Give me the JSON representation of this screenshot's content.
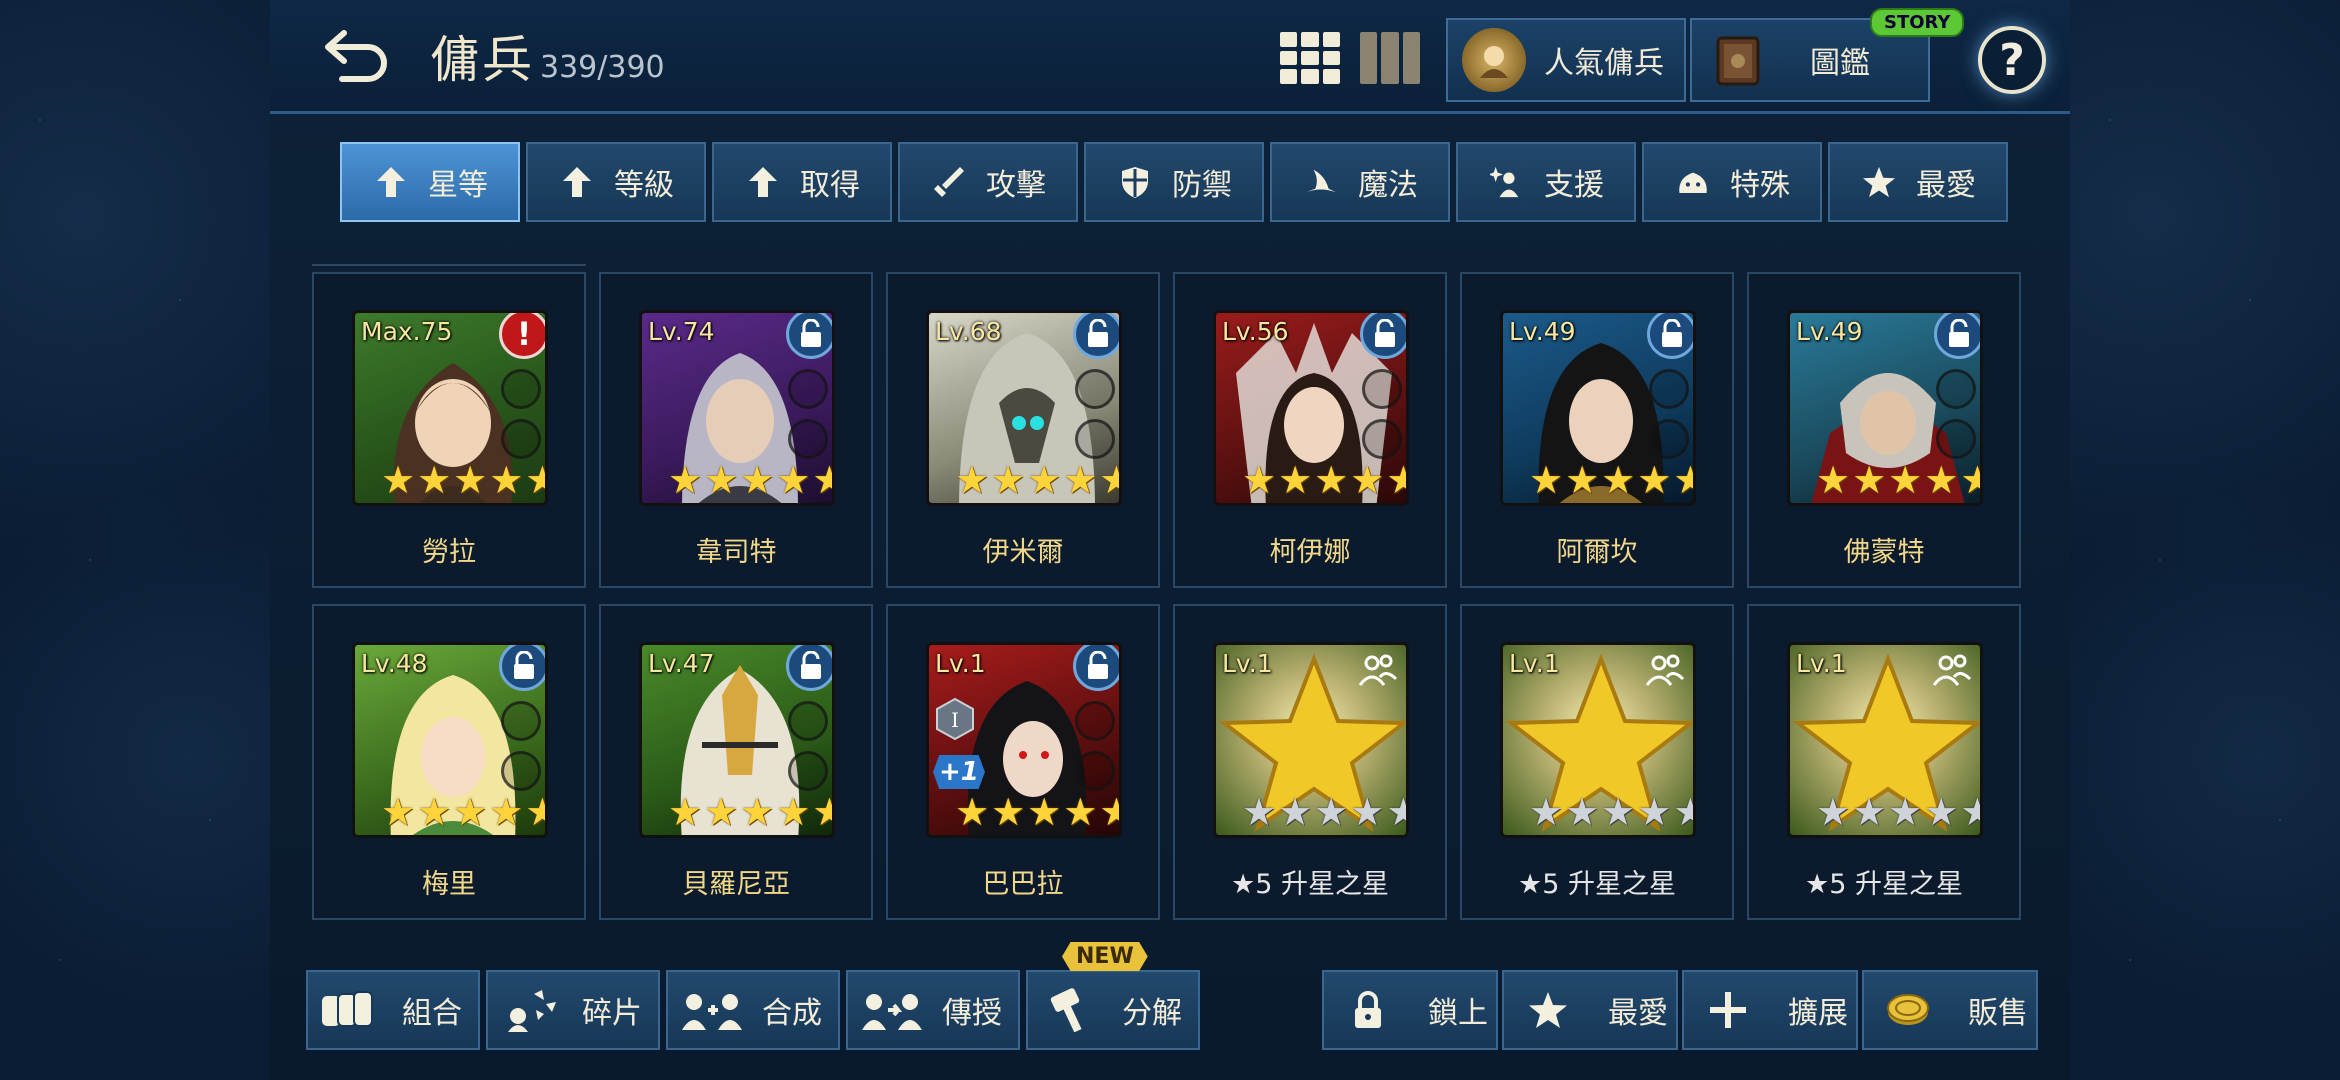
{
  "header": {
    "title": "傭兵",
    "count": "339/390",
    "popular_label": "人氣傭兵",
    "collection_label": "圖鑑",
    "story_badge": "STORY",
    "help_symbol": "?"
  },
  "filters": [
    {
      "label": "星等",
      "icon": "arrow-up-icon",
      "active": true
    },
    {
      "label": "等級",
      "icon": "arrow-up-icon",
      "active": false
    },
    {
      "label": "取得",
      "icon": "arrow-up-icon",
      "active": false
    },
    {
      "label": "攻擊",
      "icon": "sword-icon",
      "active": false
    },
    {
      "label": "防禦",
      "icon": "shield-icon",
      "active": false
    },
    {
      "label": "魔法",
      "icon": "wizard-hat-icon",
      "active": false
    },
    {
      "label": "支援",
      "icon": "sparkle-person-icon",
      "active": false
    },
    {
      "label": "特殊",
      "icon": "slime-icon",
      "active": false
    },
    {
      "label": "最愛",
      "icon": "star-icon",
      "active": false
    }
  ],
  "cards": [
    {
      "level": "Max.75",
      "name": "勞拉",
      "badge": "alert",
      "stars": 5,
      "star_color": "gold"
    },
    {
      "level": "Lv.74",
      "name": "韋司特",
      "badge": "lock",
      "stars": 5,
      "star_color": "gold"
    },
    {
      "level": "Lv.68",
      "name": "伊米爾",
      "badge": "lock",
      "stars": 5,
      "star_color": "gold"
    },
    {
      "level": "Lv.56",
      "name": "柯伊娜",
      "badge": "lock",
      "stars": 5,
      "star_color": "gold"
    },
    {
      "level": "Lv.49",
      "name": "阿爾坎",
      "badge": "lock",
      "stars": 5,
      "star_color": "gold"
    },
    {
      "level": "Lv.49",
      "name": "佛蒙特",
      "badge": "lock",
      "stars": 5,
      "star_color": "gold"
    },
    {
      "level": "Lv.48",
      "name": "梅里",
      "badge": "lock",
      "stars": 5,
      "star_color": "gold"
    },
    {
      "level": "Lv.47",
      "name": "貝羅尼亞",
      "badge": "lock",
      "stars": 5,
      "star_color": "gold"
    },
    {
      "level": "Lv.1",
      "name": "巴巴拉",
      "badge": "lock",
      "stars": 5,
      "star_color": "gold",
      "rank": "I",
      "plus": "+1"
    },
    {
      "level": "Lv.1",
      "name": "★5 升星之星",
      "badge": "party",
      "stars": 5,
      "star_color": "silver"
    },
    {
      "level": "Lv.1",
      "name": "★5 升星之星",
      "badge": "party",
      "stars": 5,
      "star_color": "silver"
    },
    {
      "level": "Lv.1",
      "name": "★5 升星之星",
      "badge": "party",
      "stars": 5,
      "star_color": "silver"
    }
  ],
  "bottom_left": [
    {
      "label": "組合",
      "icon": "team-icon"
    },
    {
      "label": "碎片",
      "icon": "shards-icon"
    },
    {
      "label": "合成",
      "icon": "merge-icon"
    },
    {
      "label": "傳授",
      "icon": "transfer-icon"
    },
    {
      "label": "分解",
      "icon": "hammer-icon"
    }
  ],
  "new_badge": "NEW",
  "bottom_right": [
    {
      "label": "鎖上",
      "icon": "lock-icon"
    },
    {
      "label": "最愛",
      "icon": "star-icon"
    },
    {
      "label": "擴展",
      "icon": "plus-icon"
    },
    {
      "label": "販售",
      "icon": "coin-icon"
    }
  ],
  "colors": {
    "accent_gold": "#f0d78a",
    "active_filter": "#4d94d6",
    "panel_blue": "#173756"
  }
}
